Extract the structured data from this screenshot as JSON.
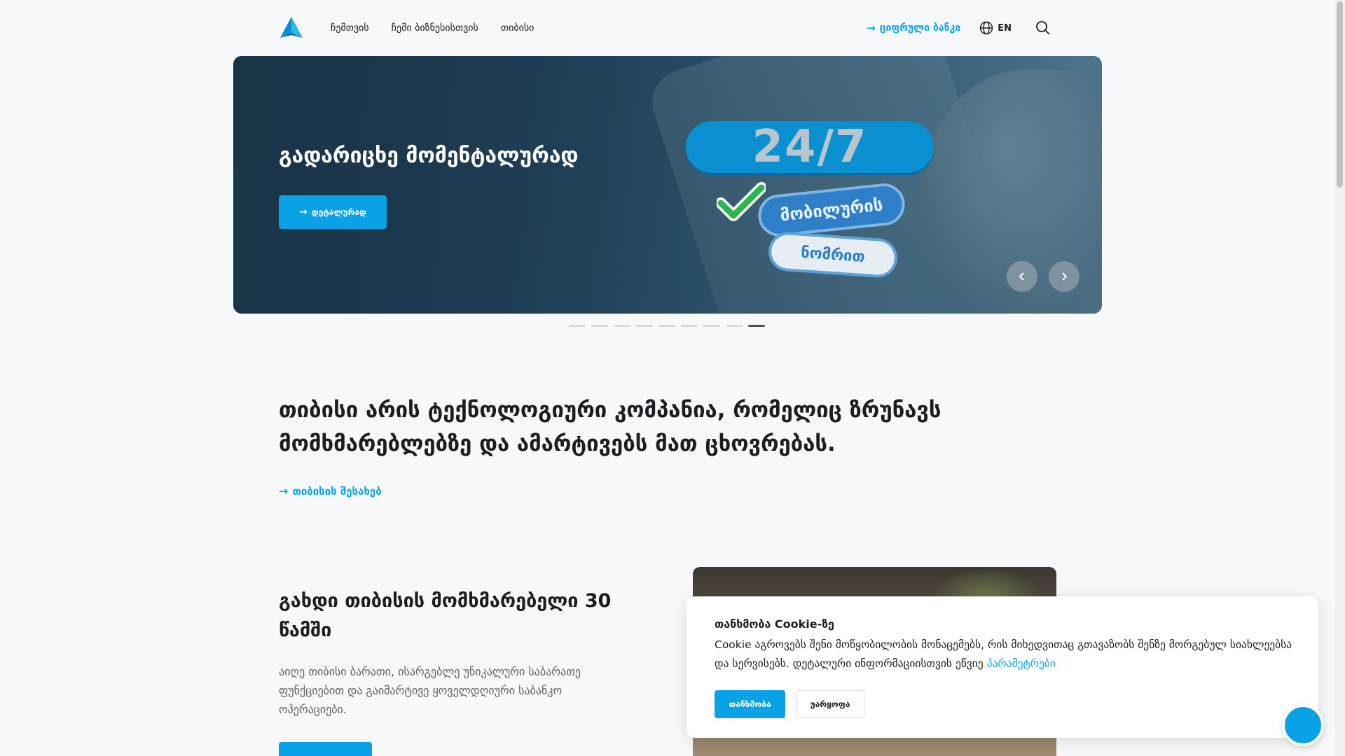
{
  "header": {
    "logo_icon": "tbc-triangle-logo",
    "nav": [
      {
        "label": "ჩემთვის"
      },
      {
        "label": "ჩემი ბიზნესისთვის"
      },
      {
        "label": "თიბისი"
      }
    ],
    "digital_bank_label": "ციფრული ბანკი",
    "lang_label": "EN",
    "lang_icon": "globe-icon",
    "search_icon": "search-icon"
  },
  "hero": {
    "title": "გადარიცხე მომენტალურად",
    "button_label": "დეტალურად",
    "badge_text": "24/7",
    "sticker1_text": "მობილურის",
    "sticker2_text": "ნომრით",
    "prev_icon": "chevron-left-icon",
    "next_icon": "chevron-right-icon",
    "slide_count": 9,
    "active_slide": 9
  },
  "about": {
    "title": "თიბისი არის ტექნოლოგიური კომპანია, რომელიც ზრუნავს მომხმარებლებზე და ამარტივებს მათ ცხოვრებას.",
    "link_label": "თიბისის შესახებ"
  },
  "become": {
    "title": "გახდი თიბისის მომხმარებელი 30 წამში",
    "text": "აიღე თიბისი ბარათი, ისარგებლე უნიკალური საბარათე ფუნქციებით და გაიმარტივე ყოველდღიური საბანკო ოპერაციები."
  },
  "cookie": {
    "title": "თანხმობა Cookie-ზე",
    "text": "Cookie აგროვებს შენი მოწყობილობის მონაცემებს, რის მიხედვითაც გთავაზობს შენზე მორგებულ სიახლეებსა და სერვისებს. დეტალური ინფორმაციისთვის ეწვიე",
    "link_label": "პარამეტრები",
    "accept_label": "თანხმობა",
    "reject_label": "უარყოფა"
  },
  "colors": {
    "accent": "#0aa2e6",
    "text": "#1a1d21",
    "background": "#f6f8f9"
  }
}
